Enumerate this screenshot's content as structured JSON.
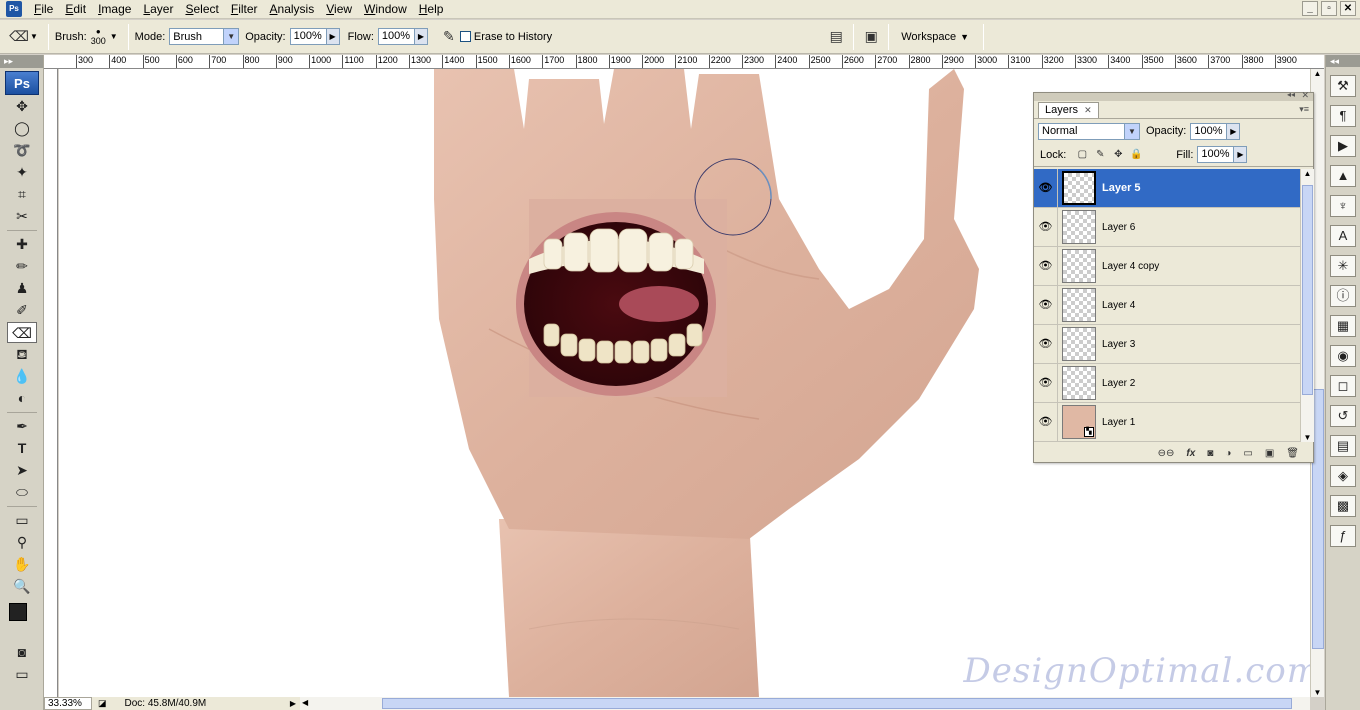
{
  "app": {
    "icon_label": "Ps"
  },
  "menu": [
    "File",
    "Edit",
    "Image",
    "Layer",
    "Select",
    "Filter",
    "Analysis",
    "View",
    "Window",
    "Help"
  ],
  "window_controls": {
    "minimize": "_",
    "restore": "▫",
    "close": "✕"
  },
  "options": {
    "brush_label": "Brush:",
    "brush_size": "300",
    "mode_label": "Mode:",
    "mode_value": "Brush",
    "opacity_label": "Opacity:",
    "opacity_value": "100%",
    "flow_label": "Flow:",
    "flow_value": "100%",
    "erase_history_label": "Erase to History",
    "workspace_label": "Workspace"
  },
  "toolbox": {
    "logo": "Ps"
  },
  "ruler_top": [
    "300",
    "400",
    "500",
    "600",
    "700",
    "800",
    "900",
    "1000",
    "1100",
    "1200",
    "1300",
    "1400",
    "1500",
    "1600",
    "1700",
    "1800",
    "1900",
    "2000",
    "2100",
    "2200",
    "2300",
    "2400",
    "2500",
    "2600",
    "2700",
    "2800",
    "2900",
    "3000",
    "3100",
    "3200",
    "3300",
    "3400",
    "3500",
    "3600",
    "3700",
    "3800",
    "3900"
  ],
  "status": {
    "zoom": "33.33%",
    "doc": "Doc: 45.8M/40.9M"
  },
  "watermark": "DesignOptimal.com",
  "layers_panel": {
    "tab_label": "Layers",
    "blend_mode": "Normal",
    "opacity_label": "Opacity:",
    "opacity_value": "100%",
    "lock_label": "Lock:",
    "fill_label": "Fill:",
    "fill_value": "100%",
    "layers": [
      {
        "name": "Layer 5",
        "selected": true
      },
      {
        "name": "Layer 6",
        "selected": false
      },
      {
        "name": "Layer 4 copy",
        "selected": false
      },
      {
        "name": "Layer 4",
        "selected": false
      },
      {
        "name": "Layer 3",
        "selected": false
      },
      {
        "name": "Layer 2",
        "selected": false
      },
      {
        "name": "Layer 1",
        "selected": false
      }
    ]
  }
}
